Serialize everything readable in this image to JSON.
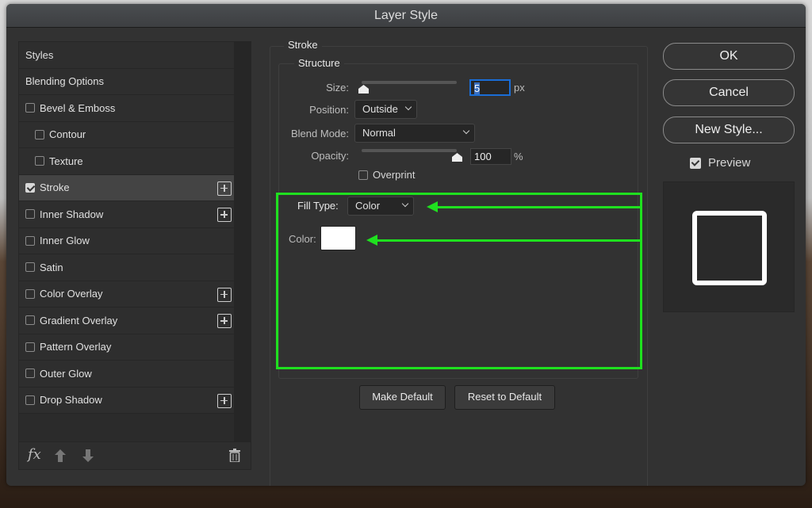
{
  "window": {
    "title": "Layer Style"
  },
  "sidebar": {
    "items": [
      {
        "label": "Styles",
        "checkbox": false,
        "checked": false,
        "plus": false
      },
      {
        "label": "Blending Options",
        "checkbox": false,
        "checked": false,
        "plus": false
      },
      {
        "label": "Bevel & Emboss",
        "checkbox": true,
        "checked": false,
        "plus": false
      },
      {
        "label": "Contour",
        "checkbox": true,
        "checked": false,
        "plus": false,
        "indent": true
      },
      {
        "label": "Texture",
        "checkbox": true,
        "checked": false,
        "plus": false,
        "indent": true
      },
      {
        "label": "Stroke",
        "checkbox": true,
        "checked": true,
        "plus": true,
        "selected": true
      },
      {
        "label": "Inner Shadow",
        "checkbox": true,
        "checked": false,
        "plus": true
      },
      {
        "label": "Inner Glow",
        "checkbox": true,
        "checked": false,
        "plus": false
      },
      {
        "label": "Satin",
        "checkbox": true,
        "checked": false,
        "plus": false
      },
      {
        "label": "Color Overlay",
        "checkbox": true,
        "checked": false,
        "plus": true
      },
      {
        "label": "Gradient Overlay",
        "checkbox": true,
        "checked": false,
        "plus": true
      },
      {
        "label": "Pattern Overlay",
        "checkbox": true,
        "checked": false,
        "plus": false
      },
      {
        "label": "Outer Glow",
        "checkbox": true,
        "checked": false,
        "plus": false
      },
      {
        "label": "Drop Shadow",
        "checkbox": true,
        "checked": false,
        "plus": true
      }
    ],
    "fx_label": "fx"
  },
  "stroke": {
    "title": "Stroke",
    "structure_title": "Structure",
    "size_label": "Size:",
    "size_value": "5",
    "size_unit": "px",
    "position_label": "Position:",
    "position_value": "Outside",
    "blend_label": "Blend Mode:",
    "blend_value": "Normal",
    "opacity_label": "Opacity:",
    "opacity_value": "100",
    "opacity_unit": "%",
    "opacity_fraction": 1.0,
    "size_fraction": 0.0,
    "overprint_label": "Overprint",
    "overprint_checked": false,
    "fill_type_label": "Fill Type:",
    "fill_type_value": "Color",
    "color_label": "Color:",
    "color_value": "#ffffff",
    "make_default": "Make Default",
    "reset_default": "Reset to Default"
  },
  "actions": {
    "ok": "OK",
    "cancel": "Cancel",
    "new_style": "New Style...",
    "preview_label": "Preview",
    "preview_checked": true
  },
  "colors": {
    "highlight": "#1fe01f",
    "focus": "#1a6dd6"
  }
}
